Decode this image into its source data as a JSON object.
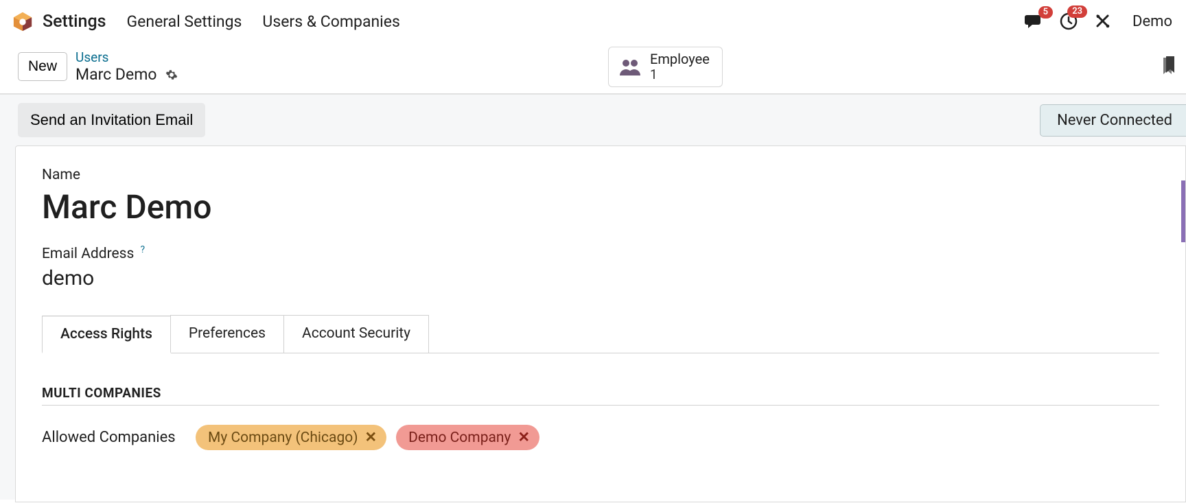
{
  "top": {
    "app_title": "Settings",
    "menu": [
      "General Settings",
      "Users & Companies"
    ],
    "discuss_badge": "5",
    "activity_badge": "23",
    "user_display": "Demo"
  },
  "controls": {
    "new_label": "New",
    "breadcrumb_link": "Users",
    "breadcrumb_current": "Marc Demo",
    "stat_label": "Employee",
    "stat_count": "1"
  },
  "statusbar": {
    "invite_label": "Send an Invitation Email",
    "status_label": "Never Connected"
  },
  "form": {
    "name_label": "Name",
    "name_value": "Marc Demo",
    "email_label": "Email Address",
    "email_help": "?",
    "email_value": "demo",
    "tabs": [
      "Access Rights",
      "Preferences",
      "Account Security"
    ],
    "active_tab_index": 0,
    "section_multi": "MULTI COMPANIES",
    "allowed_label": "Allowed Companies",
    "allowed_tags": [
      {
        "label": "My Company (Chicago)",
        "color": "orange"
      },
      {
        "label": "Demo Company",
        "color": "red"
      }
    ]
  }
}
